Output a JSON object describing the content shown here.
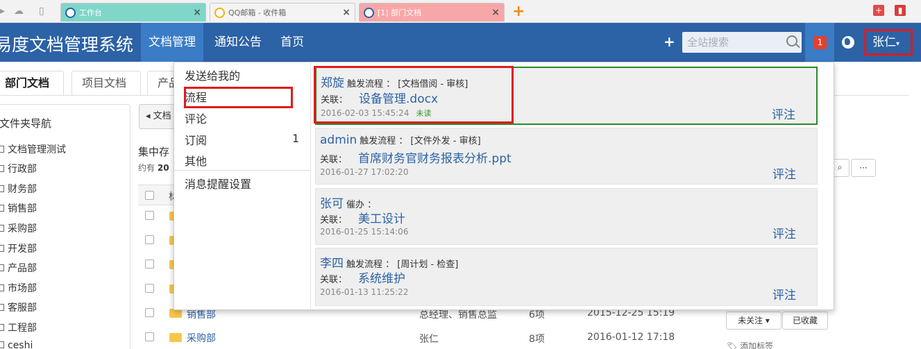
{
  "browser": {
    "tabs": [
      {
        "label": "工作台",
        "color": "#7fd6c9"
      },
      {
        "label": "QQ邮箱 - 收件箱",
        "color": "#f4f4f4"
      },
      {
        "label": "[1] 部门文档",
        "color": "#f7a7a7"
      }
    ],
    "new_tab": "+",
    "close": "×"
  },
  "header": {
    "app_title": "易度文档管理系统",
    "nav": [
      "文档管理",
      "通知公告",
      "首页"
    ],
    "plus": "+",
    "search_placeholder": "全站搜索",
    "notification_count": "1",
    "user": "张仁",
    "user_caret": "▾",
    "accent": "#2c62a6"
  },
  "page": {
    "tabs": [
      "部门文档",
      "项目文档",
      "产品"
    ],
    "folder_nav_title": "文件夹导航",
    "folders": [
      "文档管理测试",
      "行政部",
      "财务部",
      "销售部",
      "采购部",
      "开发部",
      "产品部",
      "市场部",
      "客服部",
      "工程部",
      "ceshi"
    ],
    "back_button": "◂ 文档",
    "heading": "集中存",
    "count_prefix": "约有",
    "count_value": "20",
    "column_first": "标",
    "rows": [
      {
        "name": "销售部",
        "owner": "总经理、销售总监",
        "items": "6项",
        "date": "2015-12-25 15:19"
      },
      {
        "name": "采购部",
        "owner": "张仁",
        "items": "8项",
        "date": "2016-01-12 17:18"
      }
    ],
    "follow_button": "未关注 ▾",
    "favorite_button": "已收藏",
    "more_button": "···",
    "add_tag": "添加标签"
  },
  "dropdown": {
    "menu": [
      {
        "label": "发送给我的"
      },
      {
        "label": "流程"
      },
      {
        "label": "评论"
      },
      {
        "label": "订阅",
        "count": "1"
      },
      {
        "label": "其他"
      }
    ],
    "settings": "消息提醒设置",
    "messages": [
      {
        "user": "郑旋",
        "action": "触发流程 ： [文档借阅 - 审核]",
        "rel_label": "关联：",
        "rel": "设备管理.docx",
        "date": "2016-02-03 15:45:24",
        "status": "未读",
        "comment": "评注"
      },
      {
        "user": "admin",
        "action": "触发流程 ： [文件外发 - 审核]",
        "rel_label": "关联：",
        "rel": "首席财务官财务报表分析.ppt",
        "date": "2016-01-27 17:02:20",
        "status": "",
        "comment": "评注"
      },
      {
        "user": "张可",
        "action": "催办 ：",
        "rel_label": "关联：",
        "rel": "美工设计",
        "date": "2016-01-25 15:14:06",
        "status": "",
        "comment": "评注"
      },
      {
        "user": "李四",
        "action": "触发流程 ： [周计划 - 检查]",
        "rel_label": "关联：",
        "rel": "系统维护",
        "date": "2016-01-13 11:25:22",
        "status": "",
        "comment": "评注"
      }
    ]
  }
}
